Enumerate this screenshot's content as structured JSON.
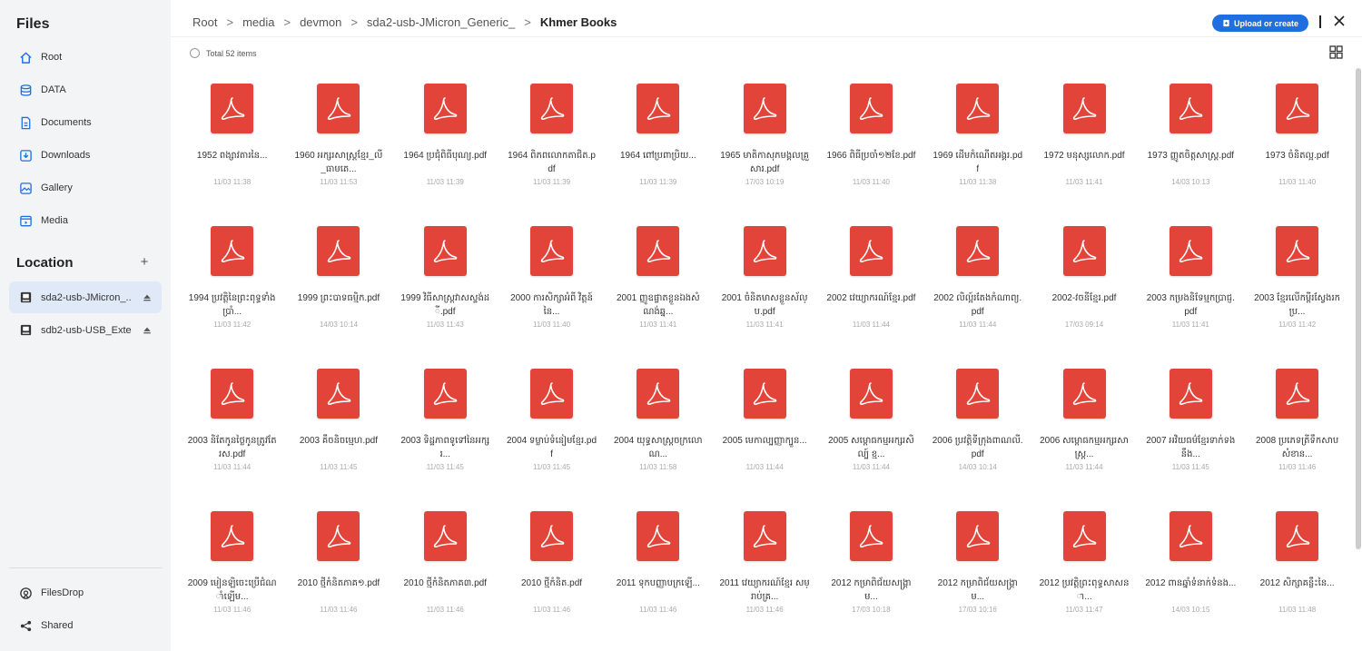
{
  "sidebar": {
    "title": "Files",
    "nav": [
      {
        "label": "Root",
        "icon": "home-icon"
      },
      {
        "label": "DATA",
        "icon": "database-icon"
      },
      {
        "label": "Documents",
        "icon": "document-icon"
      },
      {
        "label": "Downloads",
        "icon": "download-icon"
      },
      {
        "label": "Gallery",
        "icon": "gallery-icon"
      },
      {
        "label": "Media",
        "icon": "media-icon"
      }
    ],
    "location_title": "Location",
    "locations": [
      {
        "label": "sda2-usb-JMicron_..."
      },
      {
        "label": "sdb2-usb-USB_Exte..."
      }
    ],
    "bottom": [
      {
        "label": "FilesDrop",
        "icon": "filesdrop-icon"
      },
      {
        "label": "Shared",
        "icon": "share-icon"
      }
    ]
  },
  "breadcrumb": [
    "Root",
    "media",
    "devmon",
    "sda2-usb-JMicron_Generic_",
    "Khmer Books"
  ],
  "upload_label": "Upload or create",
  "total_label": "Total 52 items",
  "accent_color": "#1f6fe0",
  "pdf_color": "#e3443a",
  "files": [
    {
      "name": "1952 ពង្សាវតារនៃ...",
      "date": "11/03 11:38"
    },
    {
      "name": "1960 អក្សរសាស្ត្រខ្មែរ_លី_ធាមតេ...",
      "date": "11/03 11:53"
    },
    {
      "name": "1964 ប្រជុំពិធីបុណ្យ.pdf",
      "date": "11/03 11:39"
    },
    {
      "name": "1964 ពិភពលោកតាជិត.pdf",
      "date": "11/03 11:39"
    },
    {
      "name": "1964 ពៅប្រពាប្រិយ...",
      "date": "11/03 11:39"
    },
    {
      "name": "1965 មាតិកាសុភមង្គលគ្រួសារ.pdf",
      "date": "17/03 10:19"
    },
    {
      "name": "1966 ពិធីប្រចាំ១២ខែ.pdf",
      "date": "11/03 11:40"
    },
    {
      "name": "1969 ដើមកំណើតអង្គរ.pdf",
      "date": "11/03 11:38"
    },
    {
      "name": "1972 មនុស្សលោក.pdf",
      "date": "11/03 11:41"
    },
    {
      "name": "1973 ញ្ញូតចិត្តសាស្ត្រ.pdf",
      "date": "14/03 10:13"
    },
    {
      "name": "1973 ចំនិតល្អ.pdf",
      "date": "11/03 11:40"
    },
    {
      "name": "1994 ប្រវត្តិនៃព្រះពុទ្ធទាំងប្រាំ...",
      "date": "11/03 11:42"
    },
    {
      "name": "1999 ព្រះបាទធម្មិក.pdf",
      "date": "14/03 10:14"
    },
    {
      "name": "1999 វិធីសាស្ត្រវាសស្ទង់ដី.pdf",
      "date": "11/03 11:43"
    },
    {
      "name": "2000 ការសិក្សាអំពី វិត្តន៍ នៃ...",
      "date": "11/03 11:40"
    },
    {
      "name": "2001 ញ្ញូឧផ្ទាតខ្លួនឯងសំណង់ឆ្ន...",
      "date": "11/03 11:41"
    },
    {
      "name": "2001 ចំនិតមាសខ្លួនស័ល្ប.pdf",
      "date": "11/03 11:41"
    },
    {
      "name": "2002 វេយ្យាករណ៍ខ្មែរ.pdf",
      "date": "11/03 11:44"
    },
    {
      "name": "2002 លិល្អ៍រតែងកំណាព្យ.pdf",
      "date": "11/03 11:44"
    },
    {
      "name": "2002-វចនីខ្មែរ.pdf",
      "date": "17/03 09:14"
    },
    {
      "name": "2003 កម្រងនិទែម្មកប្រាជ្ញ.pdf",
      "date": "11/03 11:41"
    },
    {
      "name": "2003 ខ្មែរលើកម្ពីរស្វែងរកប្រ...",
      "date": "11/03 11:42"
    },
    {
      "name": "2003 និតែកូនថ្លៃកូនត្រូវតែរស.pdf",
      "date": "11/03 11:44"
    },
    {
      "name": "2003 គឹចនិចម្មេហ.pdf",
      "date": "11/03 11:45"
    },
    {
      "name": "2003 ទិដ្ឋភាពទូទៅនៃអក្សរ...",
      "date": "11/03 11:45"
    },
    {
      "name": "2004 ទម្លាប់ទំនៀមខ្មែរ.pdf",
      "date": "11/03 11:45"
    },
    {
      "name": "2004 យុទ្ធសាស្ត្រចក្រលោណ...",
      "date": "11/03 11:58"
    },
    {
      "name": "2005 មេកាល្បញ្ញាក្បួន...",
      "date": "11/03 11:44"
    },
    {
      "name": "2005 សម្ពោធកម្មអក្សរសិល្ប៍ ខ្ម...",
      "date": "11/03 11:44"
    },
    {
      "name": "2006 ប្រវត្តិទីក្រុងពាណលី.pdf",
      "date": "14/03 10:14"
    },
    {
      "name": "2006 សម្ពោធកម្មអក្សរសាស្ត្រ...",
      "date": "11/03 11:44"
    },
    {
      "name": "2007 អវិយធម៌ខ្មែរទាក់ទងនឹង...",
      "date": "11/03 11:45"
    },
    {
      "name": "2008 ប្រភេទត្រីទឹកសាបសំខាន...",
      "date": "11/03 11:46"
    },
    {
      "name": "2009 មៀនឡិចេះប្រើជំណាំឡើម...",
      "date": "11/03 11:46"
    },
    {
      "name": "2010 ថ្មីកំនិតភាគ១.pdf",
      "date": "11/03 11:46"
    },
    {
      "name": "2010 ថ្មីកំនិតភាគ៣.pdf",
      "date": "11/03 11:46"
    },
    {
      "name": "2010 ថ្មីកំនិត.pdf",
      "date": "11/03 11:46"
    },
    {
      "name": "2011 ទុកបញ្ញាបក្រឡើ...",
      "date": "11/03 11:46"
    },
    {
      "name": "2011 វេយ្យាករណ៍ខ្មែរ សម្រាប់គ្រ...",
      "date": "11/03 11:46"
    },
    {
      "name": "2012 កម្រាពិជ័យសង្គ្រាម...",
      "date": "17/03 10:18"
    },
    {
      "name": "2012 កម្រាពិជ័យសង្គ្រាម...",
      "date": "17/03 10:16"
    },
    {
      "name": "2012 ប្រវត្តិព្រះពុទ្ធសាសនា...",
      "date": "11/03 11:47"
    },
    {
      "name": "2012 ពានឆ្នាំទំនាក់ទំនង...",
      "date": "14/03 10:15"
    },
    {
      "name": "2012 សិក្សាគន្លឹះនៃ...",
      "date": "11/03 11:48"
    }
  ]
}
